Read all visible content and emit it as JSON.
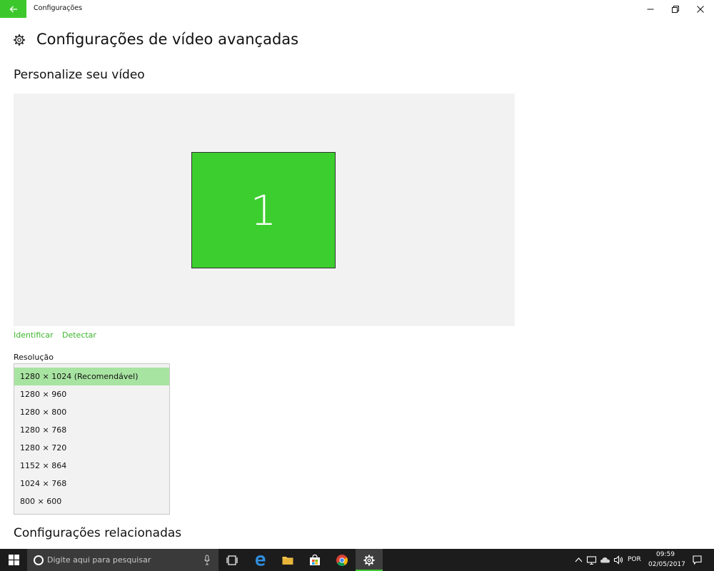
{
  "window": {
    "app_title": "Configurações"
  },
  "page": {
    "title": "Configurações de vídeo avançadas",
    "section_customize": "Personalize seu vídeo",
    "section_related": "Configurações relacionadas"
  },
  "preview": {
    "monitor_number": "1",
    "identify_link": "Identificar",
    "detect_link": "Detectar"
  },
  "resolution": {
    "label": "Resolução",
    "selected_index": 0,
    "options": [
      "1280 × 1024 (Recomendável)",
      "1280 × 960",
      "1280 × 800",
      "1280 × 768",
      "1280 × 720",
      "1152 × 864",
      "1024 × 768",
      "800 × 600"
    ]
  },
  "taskbar": {
    "search_placeholder": "Digite aqui para pesquisar",
    "language": "POR",
    "time": "09:59",
    "date": "02/05/2017"
  },
  "colors": {
    "accent": "#3cc82d",
    "monitor_fill": "#3cce2e",
    "selected_option": "#a8e4a1",
    "taskbar": "#1c1c1c"
  },
  "icons": {
    "back": "arrow-left-icon",
    "minimize": "minimize-icon",
    "restore": "restore-icon",
    "close": "close-icon",
    "settings": "gear-icon",
    "start": "windows-logo-icon",
    "cortana": "cortana-circle-icon",
    "mic": "microphone-icon",
    "task_view": "task-view-icon",
    "edge": "edge-icon",
    "explorer": "folder-icon",
    "store": "store-icon",
    "chrome": "chrome-icon",
    "settings_app": "gear-icon",
    "tray_chevron": "chevron-up-icon",
    "network": "network-icon",
    "onedrive": "cloud-icon",
    "volume": "speaker-icon",
    "notifications": "notification-icon"
  }
}
